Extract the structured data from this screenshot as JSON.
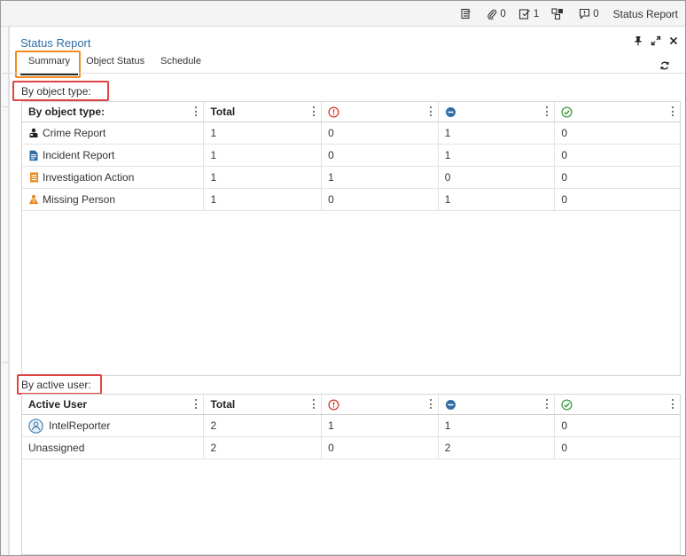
{
  "topbar": {
    "attachments_count": "0",
    "tasks_count": "1",
    "comments_count": "0",
    "report_label": "Status Report"
  },
  "panel": {
    "title": "Status Report",
    "tabs": [
      "Summary",
      "Object Status",
      "Schedule"
    ],
    "active_tab": "Summary"
  },
  "by_object_type": {
    "section_label": "By object type:",
    "columns": [
      "By object type:",
      "Total",
      "",
      "",
      ""
    ],
    "status_icons": [
      "error-circle-icon",
      "in-progress-circle-icon",
      "check-circle-icon"
    ],
    "rows": [
      {
        "name": "Crime Report",
        "icon": "crime-report-icon",
        "total": "1",
        "error": "0",
        "progress": "1",
        "done": "0"
      },
      {
        "name": "Incident Report",
        "icon": "incident-report-icon",
        "total": "1",
        "error": "0",
        "progress": "1",
        "done": "0"
      },
      {
        "name": "Investigation Action",
        "icon": "investigation-action-icon",
        "total": "1",
        "error": "1",
        "progress": "0",
        "done": "0"
      },
      {
        "name": "Missing Person",
        "icon": "missing-person-icon",
        "total": "1",
        "error": "0",
        "progress": "1",
        "done": "0"
      }
    ]
  },
  "by_active_user": {
    "section_label": "By active user:",
    "columns": [
      "Active User",
      "Total",
      "",
      "",
      ""
    ],
    "rows": [
      {
        "name": "IntelReporter",
        "icon": "user-avatar-icon",
        "total": "2",
        "error": "1",
        "progress": "1",
        "done": "0"
      },
      {
        "name": "Unassigned",
        "icon": "",
        "total": "2",
        "error": "0",
        "progress": "2",
        "done": "0"
      }
    ]
  },
  "colors": {
    "accent": "#2e6da4",
    "highlight_orange": "#f08a24",
    "highlight_red": "#e04444",
    "error": "#d9342b",
    "progress": "#2e6da4",
    "done": "#3c9a3c",
    "object_icon_orange": "#e8861a"
  }
}
